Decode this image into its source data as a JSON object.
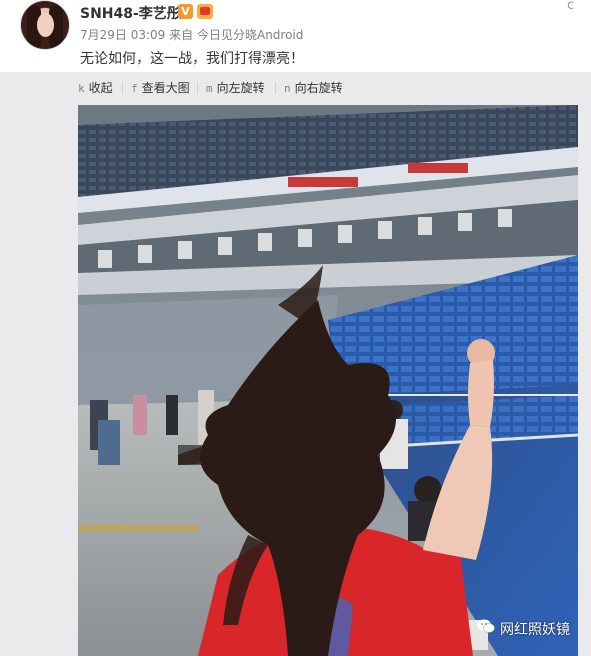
{
  "post": {
    "username": "SNH48-李艺彤",
    "verified_badge": "V",
    "timestamp": "7月29日 03:09",
    "source_prefix": "来自",
    "source": "今日见分晓Android",
    "text": "无论如何，这一战，我们打得漂亮！",
    "menu_caret": "c"
  },
  "toolbar": {
    "items": [
      {
        "key": "k",
        "label": "收起"
      },
      {
        "key": "f",
        "label": "查看大图"
      },
      {
        "key": "m",
        "label": "向左旋转"
      },
      {
        "key": "n",
        "label": "向右旋转"
      }
    ]
  },
  "watermark": {
    "text": "网红照妖镜",
    "icon": "wechat-icon"
  },
  "colors": {
    "seat_blue": "#2f63b8",
    "shirt_red": "#d8262b",
    "verified_orange": "#f29a2e"
  }
}
